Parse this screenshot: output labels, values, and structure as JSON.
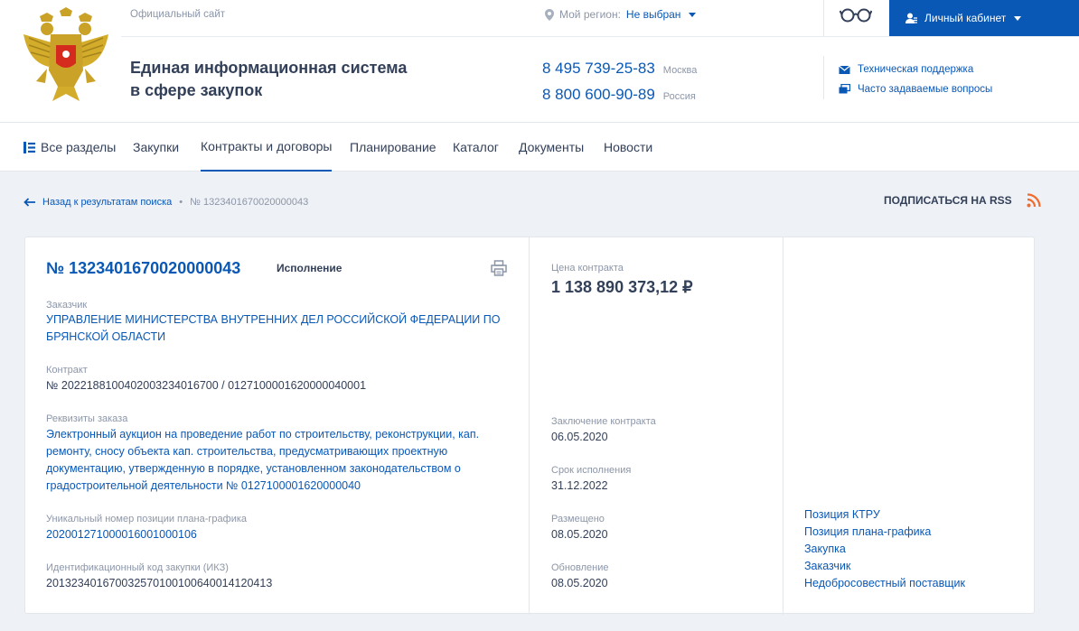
{
  "header": {
    "official_site": "Официальный сайт",
    "title_line1": "Единая информационная система",
    "title_line2": "в сфере закупок",
    "region_label": "Мой регион:",
    "region_value": "Не выбран",
    "phones": [
      {
        "number": "8 495 739-25-83",
        "region": "Москва"
      },
      {
        "number": "8 800 600-90-89",
        "region": "Россия"
      }
    ],
    "cabinet_label": "Личный кабинет",
    "support_label": "Техническая поддержка",
    "faq_label": "Часто задаваемые вопросы"
  },
  "nav": {
    "all_sections": "Все разделы",
    "purchases": "Закупки",
    "contracts": "Контракты и договоры",
    "planning": "Планирование",
    "catalog": "Каталог",
    "documents": "Документы",
    "news": "Новости"
  },
  "breadcrumb": {
    "back_label": "Назад к результатам поиска",
    "separator": "•",
    "current": "№ 1323401670020000043"
  },
  "rss_label": "ПОДПИСАТЬСЯ НА RSS",
  "contract": {
    "number": "№ 1323401670020000043",
    "status": "Исполнение",
    "customer_label": "Заказчик",
    "customer_line1": "УПРАВЛЕНИЕ МИНИСТЕРСТВА ВНУТРЕННИХ ДЕЛ РОССИЙСКОЙ ФЕДЕРАЦИИ ПО",
    "customer_line2": "БРЯНСКОЙ ОБЛАСТИ",
    "contract_label": "Контракт",
    "contract_value": "№ 2022188100402003234016700  /  0127100001620000040001",
    "order_label": "Реквизиты заказа",
    "order_lines": [
      "Электронный аукцион на проведение работ по строительству, реконструкции, кап.",
      "ремонту, сносу объекта кап. строительства, предусматривающих проектную",
      "документацию, утвержденную в порядке, установленном законодательством о",
      "градостроительной деятельности № 0127100001620000040"
    ],
    "plan_position_label": "Уникальный номер позиции плана-графика",
    "plan_position_value": "202001271000016001000106",
    "ikz_label": "Идентификационный код закупки (ИКЗ)",
    "ikz_value": "201323401670032570100100640014120413",
    "price_label": "Цена контракта",
    "price_value": "1 138 890 373,12 ₽",
    "conclusion_label": "Заключение контракта",
    "conclusion_value": "06.05.2020",
    "execution_label": "Срок исполнения",
    "execution_value": "31.12.2022",
    "placed_label": "Размещено",
    "placed_value": "08.05.2020",
    "updated_label": "Обновление",
    "updated_value": "08.05.2020"
  },
  "side_links": [
    "Позиция КТРУ",
    "Позиция плана-графика",
    "Закупка",
    "Заказчик",
    "Недобросовестный поставщик"
  ],
  "colors": {
    "accent": "#0a58b6",
    "text": "#334059",
    "muted": "#8c96a8",
    "background": "#eef1f5",
    "rss": "#f26b2e"
  }
}
